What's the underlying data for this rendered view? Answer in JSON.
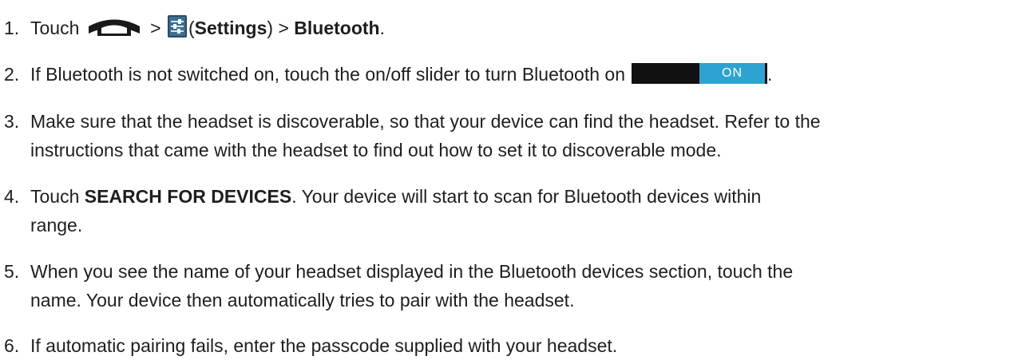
{
  "steps": [
    {
      "number": "1.",
      "touch": "Touch",
      "sep1": ">",
      "open_paren": "(",
      "settings": "Settings",
      "close_paren": ")",
      "sep2": ">",
      "bluetooth": "Bluetooth",
      "end": ".",
      "icons": [
        "home-icon",
        "settings-icon"
      ]
    },
    {
      "number": "2.",
      "text": "If Bluetooth is not switched on, touch the on/off slider to turn Bluetooth on",
      "toggle_label": "ON",
      "end": ".",
      "toggle_color": "#2ea3d1"
    },
    {
      "number": "3.",
      "line1": "Make sure that the headset is discoverable, so that your device can find the headset. Refer to the",
      "line2": "instructions that came with the headset to find out how to set it to discoverable mode."
    },
    {
      "number": "4.",
      "touch": "Touch",
      "search": "SEARCH FOR DEVICES",
      "rest": ". Your device will start to scan for Bluetooth devices within",
      "line2": "range."
    },
    {
      "number": "5.",
      "line1": "When you see the name of your headset displayed in the Bluetooth devices section, touch the",
      "line2": "name. Your device then automatically tries to pair with the headset."
    },
    {
      "number": "6.",
      "text": "If automatic pairing fails, enter the passcode supplied with your headset."
    }
  ]
}
